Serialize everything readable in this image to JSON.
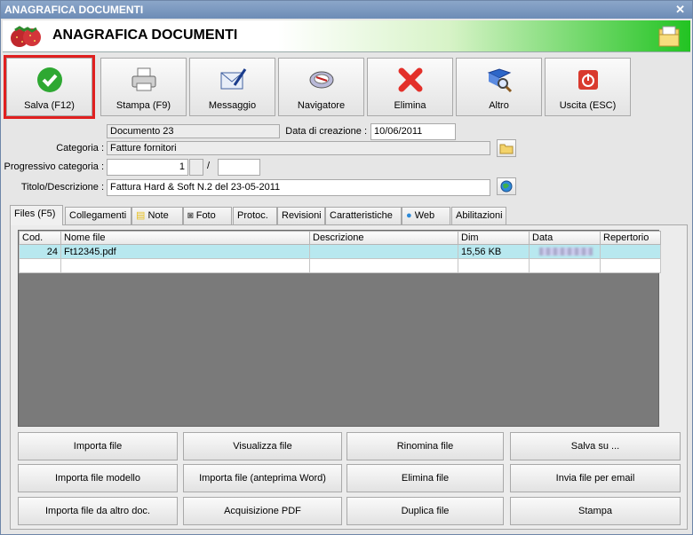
{
  "window": {
    "title": "ANAGRAFICA DOCUMENTI"
  },
  "header": {
    "title": "ANAGRAFICA DOCUMENTI"
  },
  "toolbar": [
    {
      "label": "Salva (F12)",
      "icon": "check-icon"
    },
    {
      "label": "Stampa (F9)",
      "icon": "printer-icon"
    },
    {
      "label": "Messaggio",
      "icon": "mail-icon"
    },
    {
      "label": "Navigatore",
      "icon": "compass-icon"
    },
    {
      "label": "Elimina",
      "icon": "delete-icon"
    },
    {
      "label": "Altro",
      "icon": "book-search-icon"
    },
    {
      "label": "Uscita (ESC)",
      "icon": "exit-icon"
    }
  ],
  "form": {
    "documento": "Documento 23",
    "data_creazione_label": "Data di creazione :",
    "data_creazione": "10/06/2011",
    "categoria_label": "Categoria :",
    "categoria": "Fatture fornitori",
    "progressivo_label": "Progressivo categoria :",
    "progressivo_value": "1",
    "progressivo_sep": "/",
    "titolo_label": "Titolo/Descrizione :",
    "titolo": "Fattura Hard & Soft N.2 del 23-05-2011"
  },
  "tabs": [
    "Files (F5)",
    "Collegamenti",
    "Note",
    "Foto",
    "Protoc.",
    "Revisioni",
    "Caratteristiche",
    "Web",
    "Abilitazioni"
  ],
  "grid": {
    "columns": [
      "Cod.",
      "Nome file",
      "Descrizione",
      "Dim",
      "Data",
      "Repertorio"
    ],
    "rows": [
      {
        "cod": "24",
        "nome": "Ft12345.pdf",
        "descrizione": "",
        "dim": "15,56 KB",
        "data": "",
        "repertorio": ""
      }
    ]
  },
  "actions": [
    [
      "Importa file",
      "Visualizza file",
      "Rinomina file",
      "Salva su ..."
    ],
    [
      "Importa file modello",
      "Importa file (anteprima Word)",
      "Elimina file",
      "Invia file per email"
    ],
    [
      "Importa file da altro doc.",
      "Acquisizione PDF",
      "Duplica file",
      "Stampa"
    ]
  ]
}
